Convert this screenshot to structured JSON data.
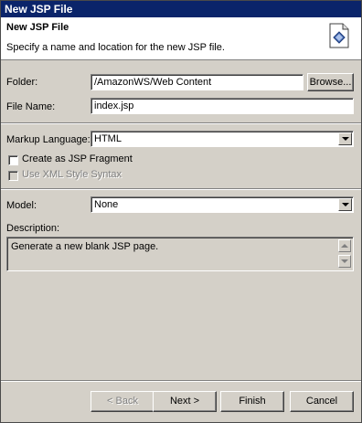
{
  "window": {
    "title": "New JSP File"
  },
  "header": {
    "title": "New JSP File",
    "description": "Specify a name and location for the new JSP file.",
    "icon": "jsp-file-wizard-icon"
  },
  "form": {
    "folder_label": "Folder:",
    "folder_value": "/AmazonWS/Web Content",
    "browse_label": "Browse...",
    "file_name_label": "File Name:",
    "file_name_value": "index.jsp",
    "markup_language_label": "Markup Language:",
    "markup_language_value": "HTML",
    "create_fragment_label": "Create as JSP Fragment",
    "create_fragment_checked": false,
    "xml_syntax_label": "Use XML Style Syntax",
    "xml_syntax_checked": false,
    "model_label": "Model:",
    "model_value": "None",
    "description_label": "Description:",
    "description_value": "Generate a new blank JSP page."
  },
  "buttons": {
    "back": "< Back",
    "next": "Next >",
    "finish": "Finish",
    "cancel": "Cancel"
  },
  "colors": {
    "titlebar": "#0a246a",
    "dialog_bg": "#d4d0c8"
  }
}
